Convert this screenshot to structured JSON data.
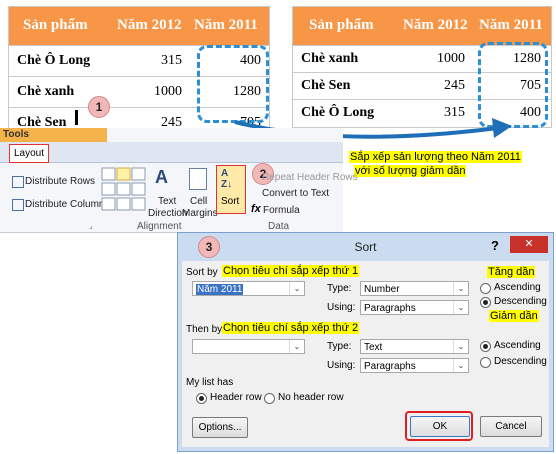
{
  "table_before": {
    "headers": [
      "Sản phẩm",
      "Năm 2012",
      "Năm 2011"
    ],
    "rows": [
      [
        "Chè Ô Long",
        "315",
        "400"
      ],
      [
        "Chè xanh",
        "1000",
        "1280"
      ],
      [
        "Chè Sen",
        "245",
        "705"
      ]
    ]
  },
  "table_after": {
    "headers": [
      "Sản phẩm",
      "Năm 2012",
      "Năm 2011"
    ],
    "rows": [
      [
        "Chè xanh",
        "1000",
        "1280"
      ],
      [
        "Chè Sen",
        "245",
        "705"
      ],
      [
        "Chè Ô Long",
        "315",
        "400"
      ]
    ]
  },
  "step_badges": [
    "1",
    "2",
    "3"
  ],
  "caption": {
    "line1": "Sắp xếp sản lượng theo Năm 2011",
    "line2": "với số lượng giảm dần"
  },
  "ribbon": {
    "tools_label": "Tools",
    "layout_tab": "Layout",
    "distribute_rows": "Distribute Rows",
    "distribute_columns": "Distribute Columns",
    "text_direction_1": "Text",
    "text_direction_2": "Direction",
    "cell_margins_1": "Cell",
    "cell_margins_2": "Margins",
    "sort": "Sort",
    "repeat_header_rows": "Repeat Header Rows",
    "convert_to_text": "Convert to Text",
    "formula": "Formula",
    "group_alignment": "Alignment",
    "group_data": "Data"
  },
  "dialog": {
    "title": "Sort",
    "help": "?",
    "close": "✕",
    "sort_by_label": "Sort by",
    "sort_by_note": "Chọn tiêu chí sắp xếp thứ 1",
    "sort_by_value": "Năm 2011",
    "type_label": "Type:",
    "type_value_1": "Number",
    "using_label": "Using:",
    "using_value_1": "Paragraphs",
    "ascending": "Ascending",
    "descending": "Descending",
    "tang_dan": "Tăng dần",
    "giam_dan": "Giảm dần",
    "then_by_label": "Then by",
    "then_by_note": "Chọn tiêu chí sắp xếp thứ 2",
    "then_by_value": "",
    "type_value_2": "Text",
    "using_value_2": "Paragraphs",
    "list_has_label": "My list has",
    "header_row": "Header row",
    "no_header_row": "No header row",
    "options_button": "Options...",
    "ok_button": "OK",
    "cancel_button": "Cancel"
  },
  "colors": {
    "table_header": "#f79646",
    "highlight_dash": "#2e8fd5",
    "caption_bg": "#ffff00",
    "ok_outline": "#e02020"
  }
}
